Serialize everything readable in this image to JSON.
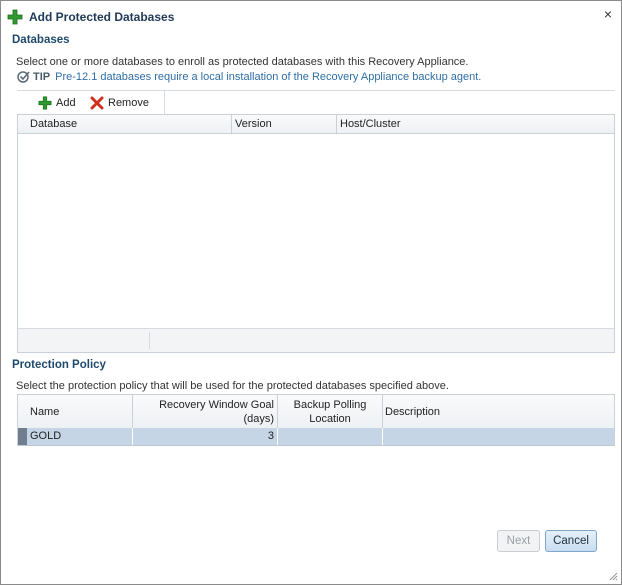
{
  "dialog": {
    "title": "Add Protected Databases",
    "close_glyph": "×"
  },
  "databases": {
    "section_title": "Databases",
    "description": "Select one or more databases to enroll as protected databases with this Recovery Appliance.",
    "tip_label": "TIP",
    "tip_text": "Pre-12.1 databases require a local installation of the Recovery Appliance backup agent.",
    "toolbar": {
      "add_label": "Add",
      "remove_label": "Remove"
    },
    "columns": [
      "Database",
      "Version",
      "Host/Cluster"
    ],
    "rows": []
  },
  "protection_policy": {
    "section_title": "Protection Policy",
    "description": "Select the protection policy that will be used for the protected databases specified above.",
    "columns": {
      "name": "Name",
      "recovery_window_line1": "Recovery Window Goal",
      "recovery_window_line2": "(days)",
      "backup_polling_line1": "Backup Polling",
      "backup_polling_line2": "Location",
      "description": "Description"
    },
    "rows": [
      {
        "name": "GOLD",
        "recovery_window_days": "3",
        "backup_polling_location": "",
        "description": ""
      }
    ]
  },
  "buttons": {
    "next_label": "Next",
    "cancel_label": "Cancel"
  },
  "colors": {
    "accent_green": "#2e9a2e",
    "remove_red": "#d2301f",
    "section_blue": "#1f4a6e",
    "selected_row": "#c5d5e5"
  },
  "icons": {
    "title_icon": "add-plus-icon",
    "tip_icon": "check-circle-icon",
    "add_icon": "add-plus-icon",
    "remove_icon": "remove-x-icon",
    "close_icon": "close-icon"
  }
}
